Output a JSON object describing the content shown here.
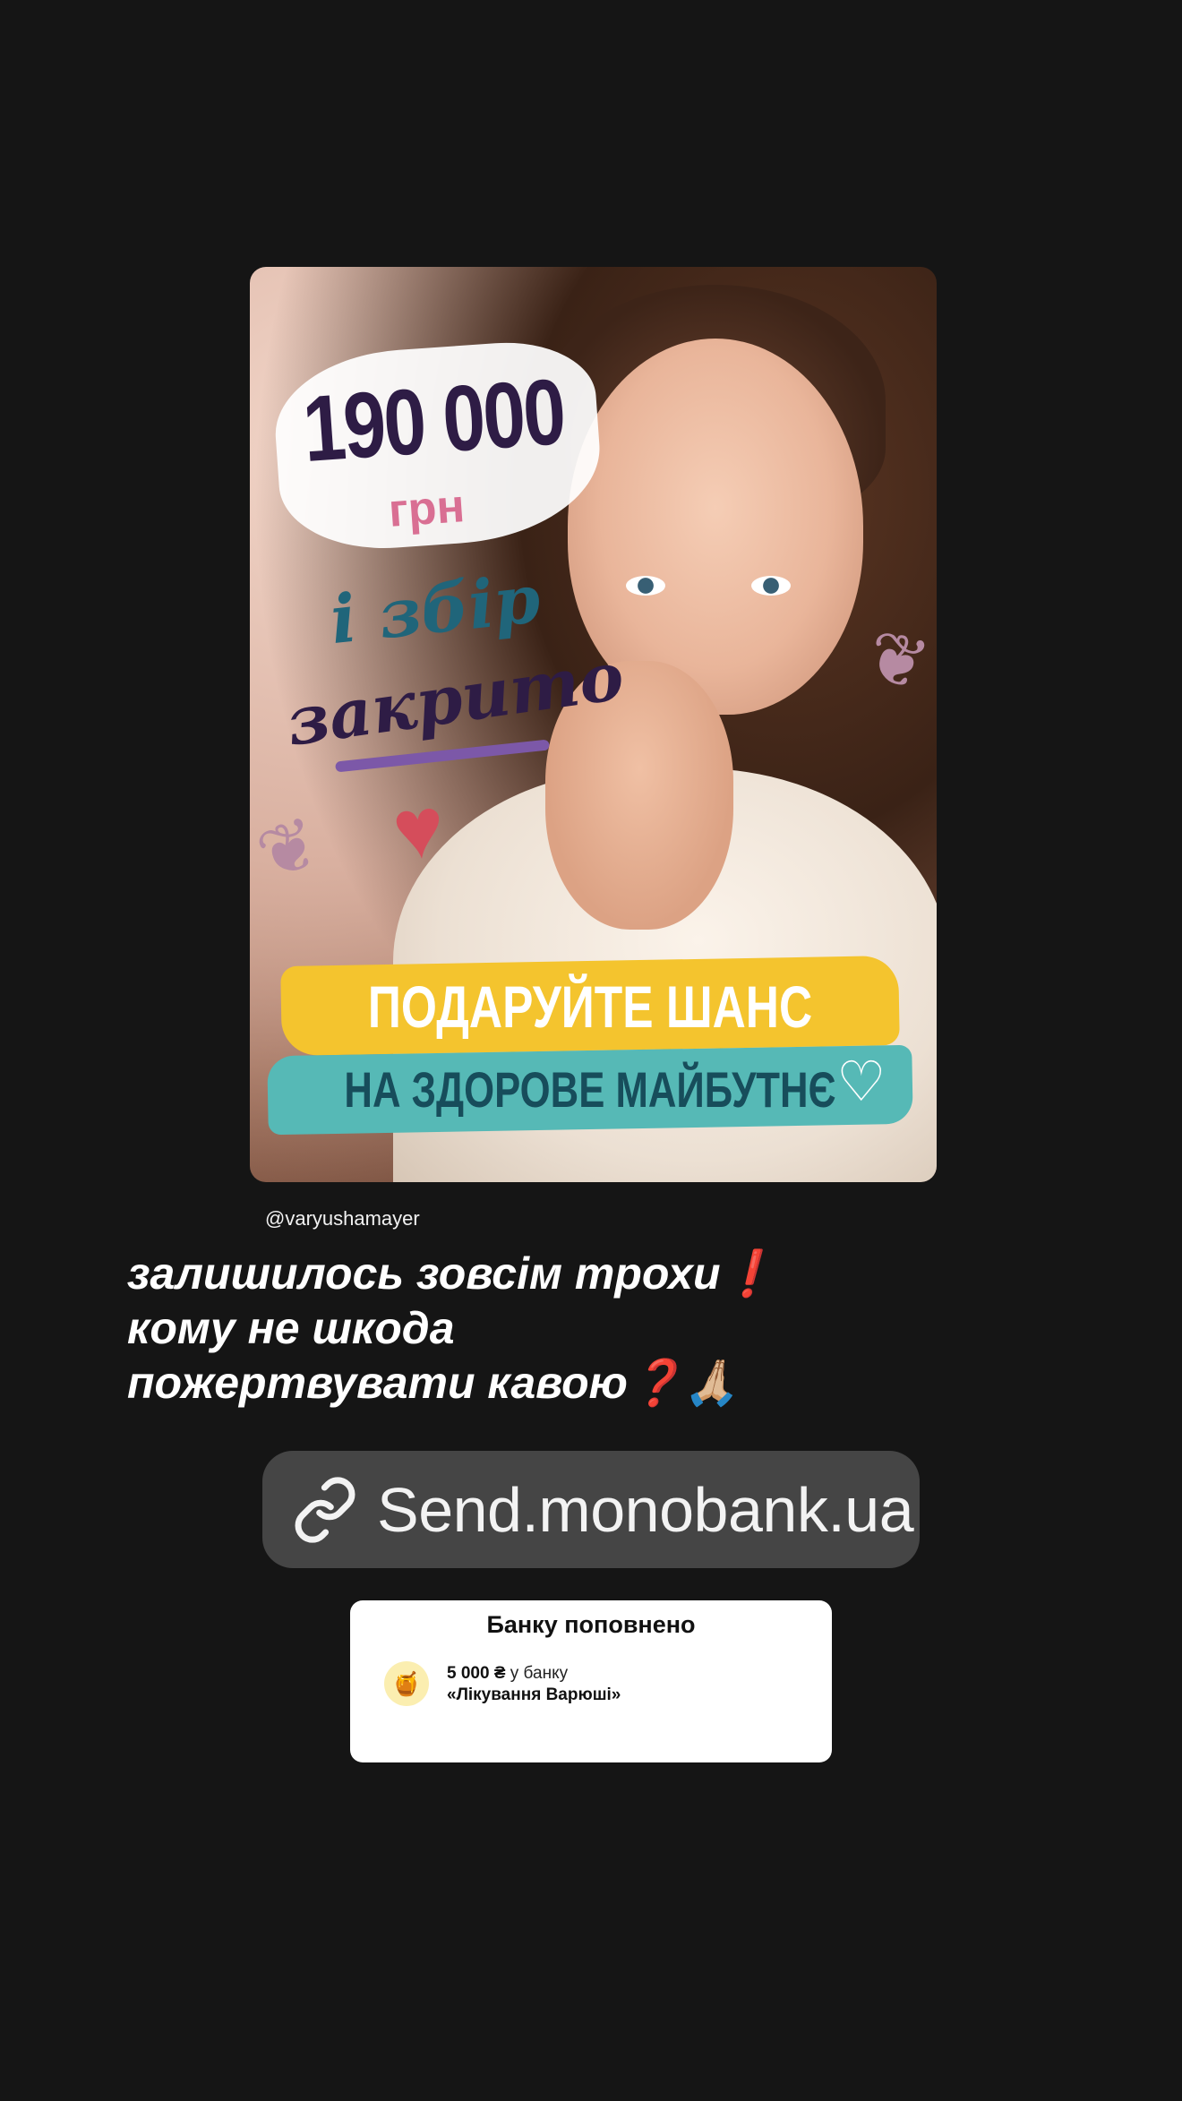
{
  "poster": {
    "amount": "190 000",
    "currency": "грн",
    "closed_line_1": "і збір",
    "closed_line_2": "закрито",
    "band_line_1": "ПОДАРУЙТЕ ШАНС",
    "band_line_2": "НА ЗДОРОВЕ МАЙБУТНЄ",
    "icons": [
      "heart-icon",
      "twig-icon",
      "small-heart-icon"
    ]
  },
  "mention": "@varyushamayer",
  "caption": {
    "line_1": "залишилось зовсім трохи❗",
    "line_2": "кому не шкода",
    "line_3": "пожертвувати кавою❓🙏🏼"
  },
  "link_sticker": {
    "icon": "link-icon",
    "label": "Send.monobank.ua"
  },
  "jar_card": {
    "title": "Банку поповнено",
    "amount": "5 000 ₴",
    "amount_suffix": " у банку",
    "jar_name": "«Лікування Варюші»",
    "avatar_icon": "🍯"
  },
  "colors": {
    "background": "#151515",
    "link_sticker_bg": "#454545",
    "card_bg": "#ffffff"
  }
}
